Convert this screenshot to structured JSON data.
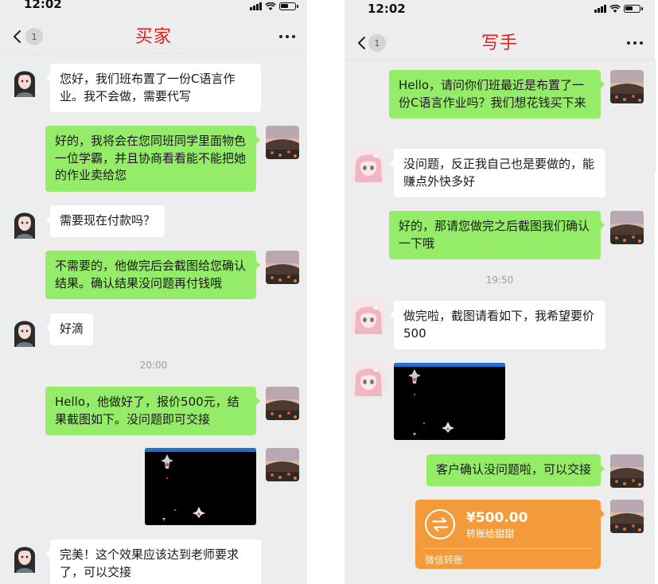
{
  "left": {
    "status_time": "12:02",
    "badge": "1",
    "title": "买家",
    "messages": [
      {
        "text": "您好，我们班布置了一份C语言作业。我不会做，需要代写"
      },
      {
        "text": "好的，我将会在您同班同学里面物色一位学霸，并且协商看看能不能把她的作业卖给您"
      },
      {
        "text": "需要现在付款吗？"
      },
      {
        "text": "不需要的，他做完后会截图给您确认结果。确认结果没问题再付钱哦"
      },
      {
        "text": "好滴"
      },
      {
        "text": "Hello，他做好了，报价500元，结果截图如下。没问题即可交接"
      },
      {
        "text": "完美！这个效果应该达到老师要求了，可以交接"
      }
    ],
    "time_divider": "20:00"
  },
  "right": {
    "status_time": "12:02",
    "badge": "1",
    "title": "写手",
    "messages": [
      {
        "text": "Hello，请问你们班最近是布置了一份C语言作业吗？我们想花钱买下来"
      },
      {
        "text": "没问题，反正我自己也是要做的，能赚点外快多好"
      },
      {
        "text": "好的，那请您做完之后截图我们确认一下哦"
      },
      {
        "text": "做完啦，截图请看如下，我希望要价500"
      },
      {
        "text": "客户确认没问题啦，可以交接"
      }
    ],
    "time_divider": "19:50",
    "transfer": {
      "amount": "¥500.00",
      "to": "转账给甜甜",
      "footer": "微信转账"
    }
  },
  "colors": {
    "sent_bubble": "#95ec69",
    "received_bubble": "#ffffff",
    "background": "#ededed",
    "title": "#e0201e",
    "transfer": "#f39b3a"
  },
  "icons": [
    "back-icon",
    "more-icon",
    "signal-icon",
    "wifi-icon",
    "battery-icon",
    "transfer-icon"
  ]
}
